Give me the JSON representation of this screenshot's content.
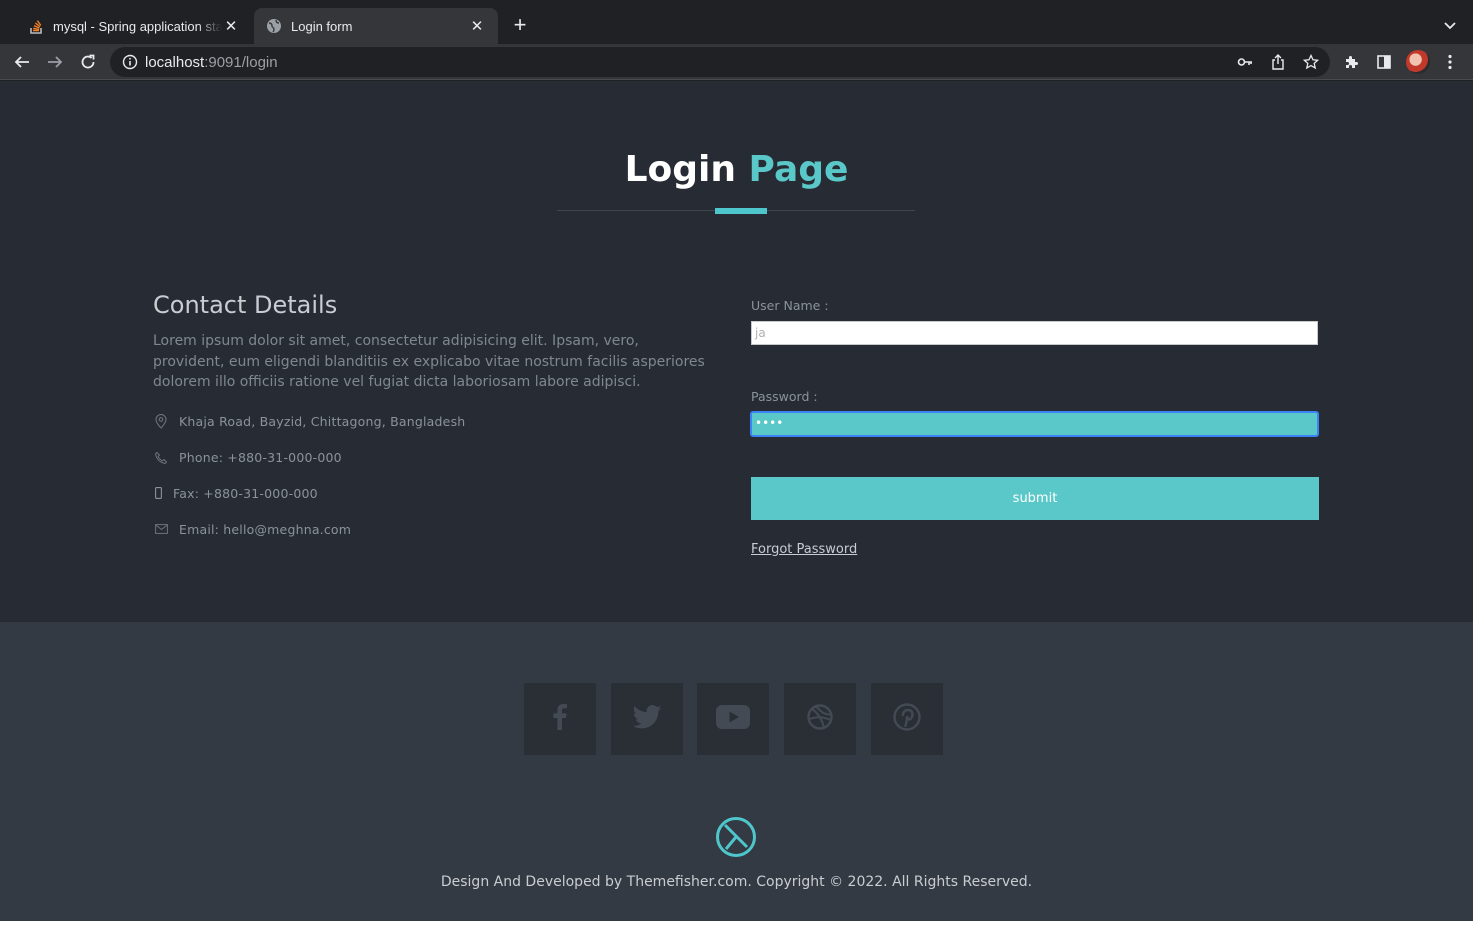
{
  "browser": {
    "tabs": [
      {
        "title": "mysql - Spring application start",
        "active": false
      },
      {
        "title": "Login form",
        "active": true
      }
    ],
    "new_tab_label": "+",
    "close_label": "✕",
    "url_host": "localhost",
    "url_rest": ":9091/login"
  },
  "page": {
    "heading_white": "Login",
    "heading_accent": "Page",
    "accent_color": "#5ac8c8",
    "contact": {
      "title": "Contact Details",
      "description": "Lorem ipsum dolor sit amet, consectetur adipisicing elit. Ipsam, vero, provident, eum eligendi blanditiis ex explicabo vitae nostrum facilis asperiores dolorem illo officiis ratione vel fugiat dicta laboriosam labore adipisci.",
      "address": "Khaja Road, Bayzid, Chittagong, Bangladesh",
      "phone": "Phone: +880-31-000-000",
      "fax": "Fax: +880-31-000-000",
      "email": "Email: hello@meghna.com"
    },
    "form": {
      "username_label": "User Name :",
      "username_value": "ja",
      "password_label": "Password :",
      "password_value": "••••",
      "submit_label": "submit",
      "forgot_label": "Forgot Password"
    }
  },
  "footer": {
    "social_icons": [
      "facebook-icon",
      "twitter-icon",
      "youtube-icon",
      "dribbble-icon",
      "pinterest-icon"
    ],
    "copyright": "Design And Developed by Themefisher.com. Copyright © 2022. All Rights Reserved."
  }
}
